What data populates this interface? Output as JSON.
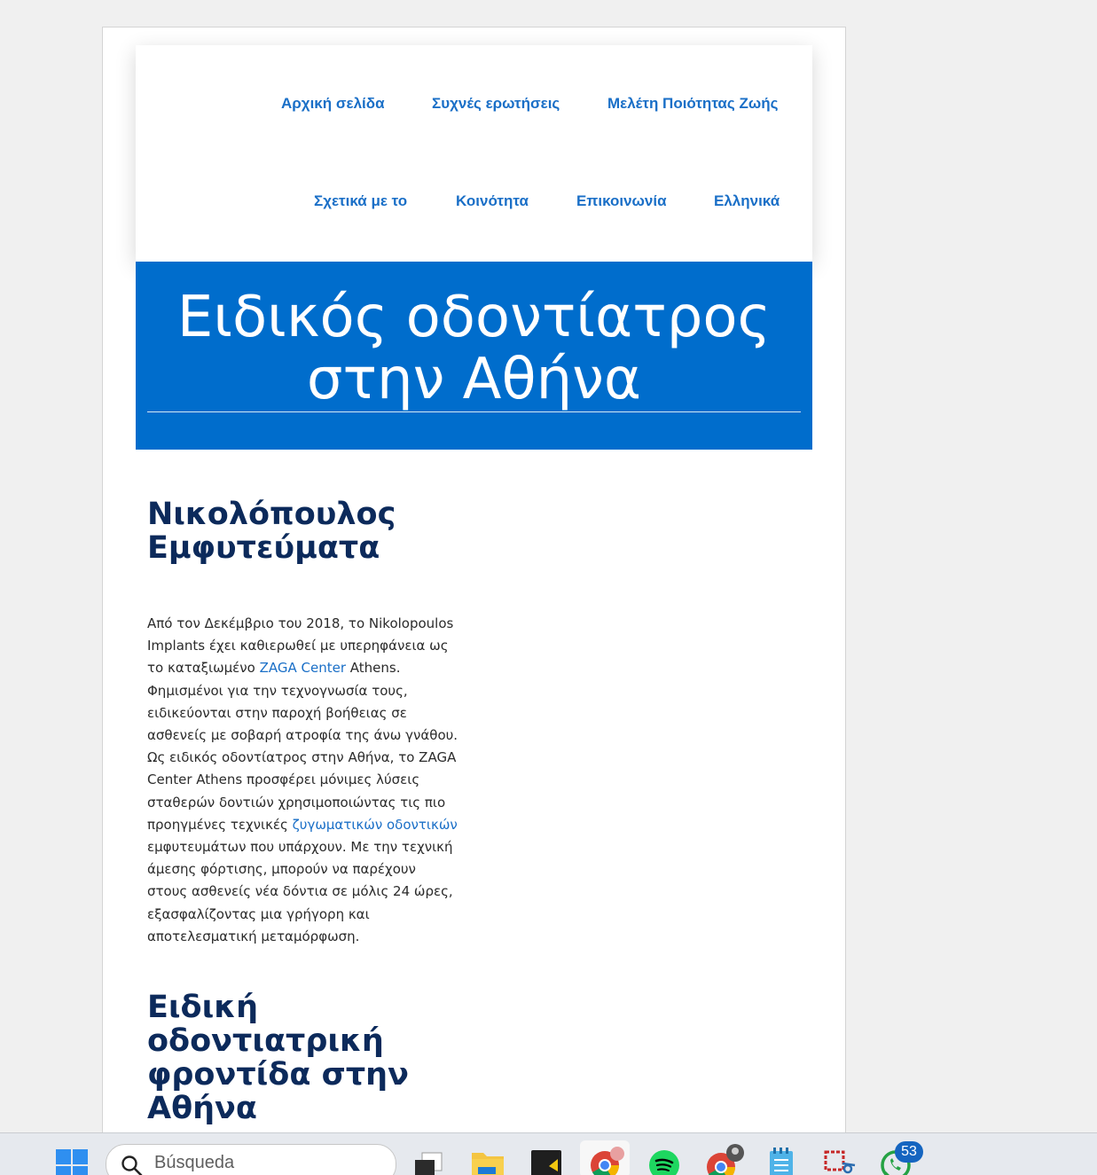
{
  "nav": {
    "row1": [
      "Αρχική σελίδα",
      "Συχνές ερωτήσεις",
      "Μελέτη Ποιότητας Ζωής"
    ],
    "row2": [
      "Σχετικά με το",
      "Κοινότητα",
      "Επικοινωνία",
      "Ελληνικά"
    ]
  },
  "hero": {
    "title_line1": "Ειδικός οδοντίατρος",
    "title_line2": "στην Αθήνα",
    "background": "#006dcc"
  },
  "section1": {
    "heading_line1": "Νικολόπουλος",
    "heading_line2": "Εμφυτεύματα",
    "paragraph": {
      "part1": "Από τον Δεκέμβριο του 2018, το Nikolopoulos\nImplants έχει καθιερωθεί με υπερηφάνεια ως\nτο καταξιωμένο ",
      "link1": "ZAGA Center",
      "part2": " Athens.\nΦημισμένοι για την τεχνογνωσία τους,\nειδικεύονται στην παροχή βοήθειας σε\nασθενείς με σοβαρή ατροφία της άνω γνάθου.\nΩς ειδικός οδοντίατρος στην Αθήνα, το ZAGA\nCenter Athens προσφέρει μόνιμες λύσεις\nσταθερών δοντιών χρησιμοποιώντας τις πιο\nπροηγμένες τεχνικές ",
      "link2": "ζυγωματικών οδοντικών",
      "part3": "\nεμφυτευμάτων που υπάρχουν. Με την τεχνική\nάμεσης φόρτισης, μπορούν να παρέχουν\nστους ασθενείς νέα δόντια σε μόλις 24 ώρες,\nεξασφαλίζοντας μια γρήγορη και\nαποτελεσματική μεταμόρφωση."
    }
  },
  "section2": {
    "heading_lines": [
      "Ειδική",
      "οδοντιατρική",
      "φροντίδα στην",
      "Αθήνα"
    ]
  },
  "taskbar": {
    "search_placeholder": "Búsqueda",
    "whatsapp_badge": "53",
    "icons": [
      "windows-start-icon",
      "task-view-icon",
      "file-explorer-icon",
      "sticky-app-icon",
      "chrome-icon",
      "spotify-icon",
      "chrome-profile-icon",
      "notepad-icon",
      "snipping-tool-icon",
      "whatsapp-icon"
    ]
  },
  "colors": {
    "link": "#1a6fc7",
    "heading": "#0c2a5b",
    "hero_bg": "#006dcc",
    "badge": "#1565c0"
  }
}
